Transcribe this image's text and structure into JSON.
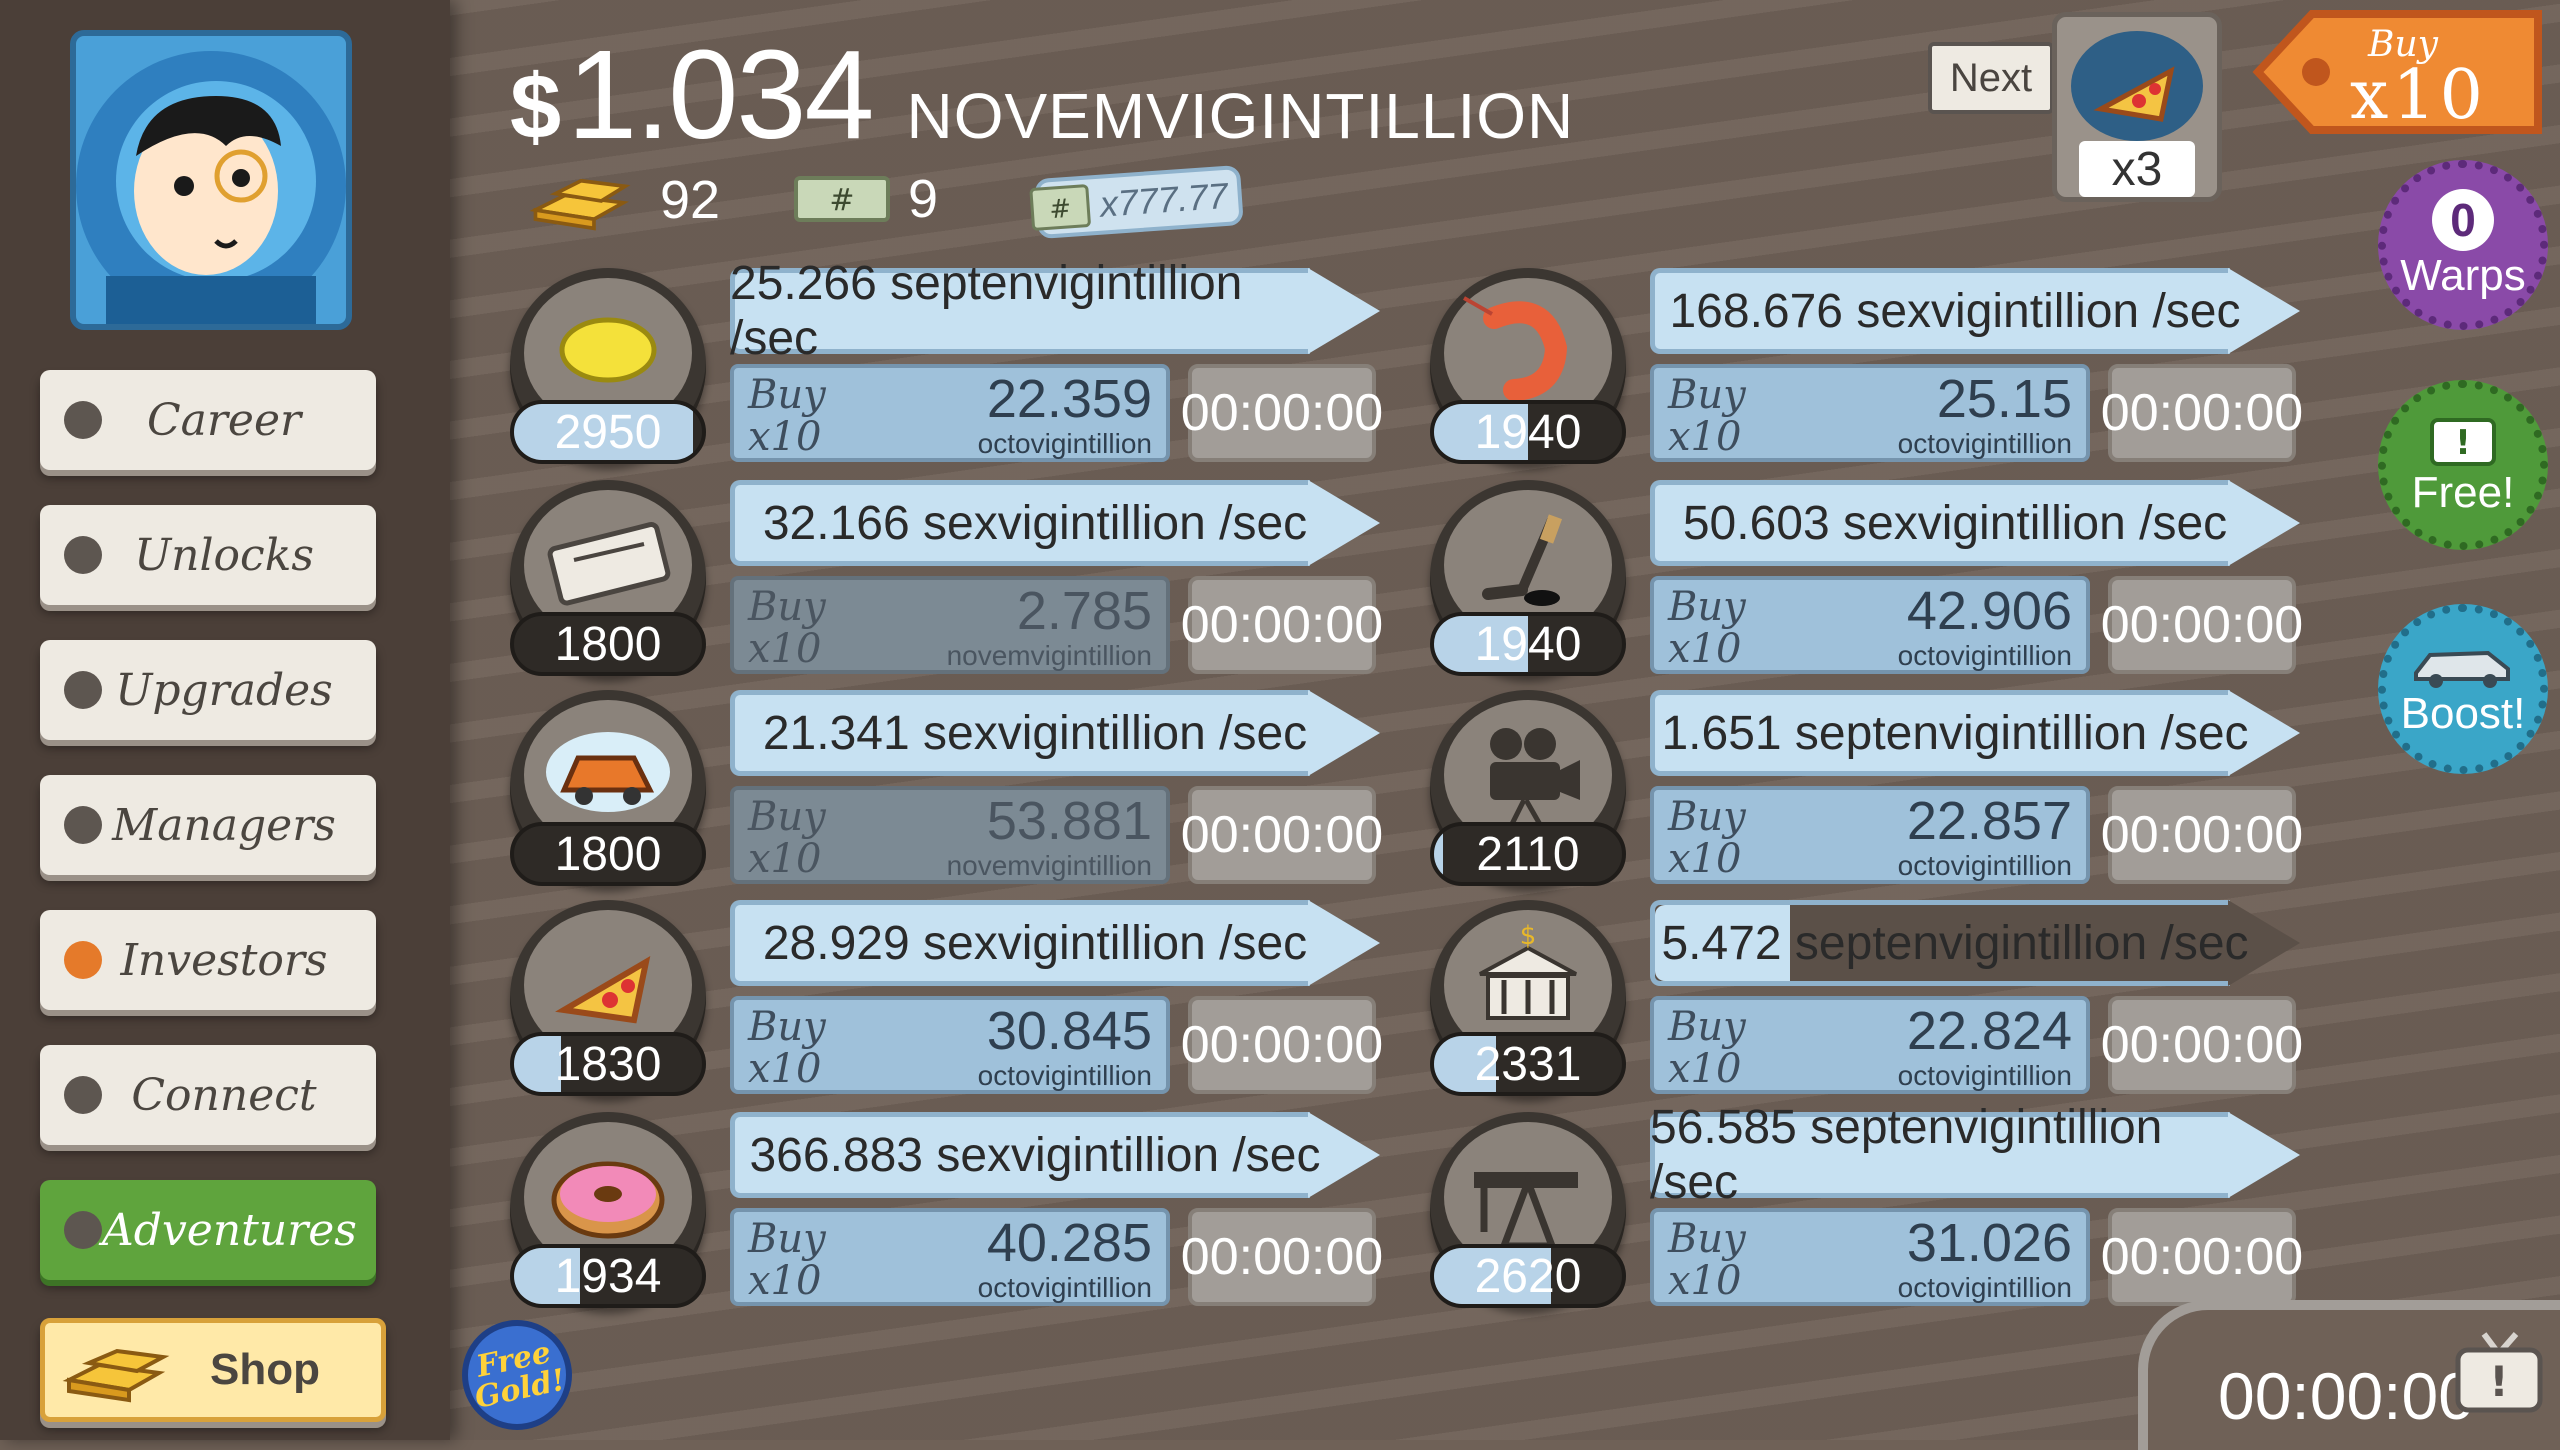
{
  "header": {
    "currency_symbol": "$",
    "money_amount": "1.034",
    "money_unit": "NOVEMVIGINTILLION",
    "gold_count": "92",
    "megabucks_count": "9",
    "multiplier_label": "x777.77"
  },
  "sidebar": {
    "items": [
      {
        "label": "Career",
        "active": false
      },
      {
        "label": "Unlocks",
        "active": false
      },
      {
        "label": "Upgrades",
        "active": false
      },
      {
        "label": "Managers",
        "active": false
      },
      {
        "label": "Investors",
        "active": true
      },
      {
        "label": "Connect",
        "active": false
      },
      {
        "label": "Adventures",
        "active": false
      }
    ],
    "shop_label": "Shop",
    "free_gold_label": "Free Gold!"
  },
  "businesses": [
    {
      "icon": "lemon-icon",
      "count": "2950",
      "progress": 0.95,
      "rate": "25.266 septenvigintillion /sec",
      "buy_label": "Buy",
      "buy_qty": "x10",
      "cost": "22.359",
      "cost_unit": "octovigintillion",
      "timer": "00:00:00",
      "affordable": true,
      "rate_progress": 1
    },
    {
      "icon": "shrimp-icon",
      "count": "1940",
      "progress": 0.5,
      "rate": "168.676 sexvigintillion /sec",
      "buy_label": "Buy",
      "buy_qty": "x10",
      "cost": "25.15",
      "cost_unit": "octovigintillion",
      "timer": "00:00:00",
      "affordable": true,
      "rate_progress": 1
    },
    {
      "icon": "newspaper-icon",
      "count": "1800",
      "progress": 0,
      "rate": "32.166 sexvigintillion /sec",
      "buy_label": "Buy",
      "buy_qty": "x10",
      "cost": "2.785",
      "cost_unit": "novemvigintillion",
      "timer": "00:00:00",
      "affordable": false,
      "rate_progress": 1
    },
    {
      "icon": "hockey-icon",
      "count": "1940",
      "progress": 0.5,
      "rate": "50.603 sexvigintillion /sec",
      "buy_label": "Buy",
      "buy_qty": "x10",
      "cost": "42.906",
      "cost_unit": "octovigintillion",
      "timer": "00:00:00",
      "affordable": true,
      "rate_progress": 1
    },
    {
      "icon": "car-wash-icon",
      "count": "1800",
      "progress": 0,
      "rate": "21.341 sexvigintillion /sec",
      "buy_label": "Buy",
      "buy_qty": "x10",
      "cost": "53.881",
      "cost_unit": "novemvigintillion",
      "timer": "00:00:00",
      "affordable": false,
      "rate_progress": 1
    },
    {
      "icon": "movie-camera-icon",
      "count": "2110",
      "progress": 0.05,
      "rate": "1.651 septenvigintillion /sec",
      "buy_label": "Buy",
      "buy_qty": "x10",
      "cost": "22.857",
      "cost_unit": "octovigintillion",
      "timer": "00:00:00",
      "affordable": true,
      "rate_progress": 1
    },
    {
      "icon": "pizza-icon",
      "count": "1830",
      "progress": 0.25,
      "rate": "28.929 sexvigintillion /sec",
      "buy_label": "Buy",
      "buy_qty": "x10",
      "cost": "30.845",
      "cost_unit": "octovigintillion",
      "timer": "00:00:00",
      "affordable": true,
      "rate_progress": 1
    },
    {
      "icon": "bank-icon",
      "count": "2331",
      "progress": 0.33,
      "rate": "5.472 septenvigintillion /sec",
      "buy_label": "Buy",
      "buy_qty": "x10",
      "cost": "22.824",
      "cost_unit": "octovigintillion",
      "timer": "00:00:00",
      "affordable": true,
      "rate_progress": 0.2
    },
    {
      "icon": "donut-icon",
      "count": "1934",
      "progress": 0.35,
      "rate": "366.883 sexvigintillion /sec",
      "buy_label": "Buy",
      "buy_qty": "x10",
      "cost": "40.285",
      "cost_unit": "octovigintillion",
      "timer": "00:00:00",
      "affordable": true,
      "rate_progress": 1
    },
    {
      "icon": "oil-rig-icon",
      "count": "2620",
      "progress": 0.62,
      "rate": "56.585 septenvigintillion /sec",
      "buy_label": "Buy",
      "buy_qty": "x10",
      "cost": "31.026",
      "cost_unit": "octovigintillion",
      "timer": "00:00:00",
      "affordable": true,
      "rate_progress": 1
    }
  ],
  "right_panel": {
    "next_label": "Next",
    "next_multiplier": "x3",
    "buy_mode_label": "Buy",
    "buy_mode_qty": "x10",
    "warps_count": "0",
    "warps_label": "Warps",
    "free_label": "Free!",
    "boost_label": "Boost!",
    "event_timer": "00:00:00"
  },
  "colors": {
    "accent_orange": "#e57a2a",
    "adventure_green": "#5fa43d",
    "warp_purple": "#8a4aa8",
    "free_green": "#4f9a3a",
    "boost_blue": "#3aa6c8",
    "bar_blue": "#c7e1f2"
  }
}
